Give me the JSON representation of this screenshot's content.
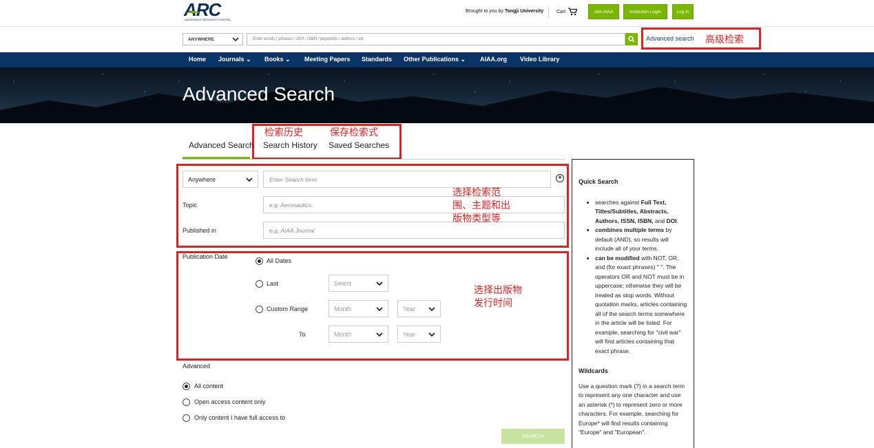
{
  "header": {
    "logo_text": "ARC",
    "logo_sub": "AEROSPACE RESEARCH CENTRAL",
    "brought_prefix": "Brought to you by",
    "institution": "Tongji University",
    "cart_label": "Cart",
    "buttons": [
      "Join AIAA",
      "Institution Login",
      "Log In"
    ]
  },
  "search": {
    "scope": "ANYWHERE",
    "placeholder": "Enter words / phrases / DOI / ISBN / keywords / authors / etc",
    "advanced_link": "Advanced search"
  },
  "nav": {
    "items": [
      "Home",
      "Journals",
      "Books",
      "Meeting Papers",
      "Standards",
      "Other Publications",
      "AIAA.org",
      "Video Library"
    ]
  },
  "hero": {
    "title": "Advanced Search"
  },
  "tabs": [
    "Advanced Search",
    "Search History",
    "Saved Searches"
  ],
  "annotations": {
    "advanced": "高级检索",
    "history": "检索历史",
    "saved": "保存检索式",
    "scope_line1": "选择检索范",
    "scope_line2": "围、主题和出",
    "scope_line3": "版物类型等",
    "date_line1": "选择出版物",
    "date_line2": "发行时间"
  },
  "form": {
    "field_select": "Anywhere",
    "term_placeholder": "Enter Search term",
    "topic_label": "Topic",
    "topic_placeholder": "e.g. Aeronautics",
    "published_label": "Published in",
    "published_placeholder": "e.g. AIAA Journal",
    "pubdate_label": "Publication Date",
    "date_options": [
      "All Dates",
      "Last",
      "Custom Range"
    ],
    "last_select": "Select",
    "month": "Month",
    "year": "Year",
    "to_label": "To",
    "advanced_label": "Advanced",
    "access_options": [
      "All content",
      "Open access content only",
      "Only content I have full access to"
    ],
    "search_button": "SEARCH"
  },
  "sidebar": {
    "quick_title": "Quick Search",
    "b1_pre": "searches against ",
    "b1_bold": "Full Text, Titles/Subtitles, Abstracts, Authors, ISSN, ISBN,",
    "b1_and": " and ",
    "b1_doi": "DOI",
    "b1_end": ".",
    "b2_bold": "combines multiple terms",
    "b2_rest": " by default (AND), so results will include all of your terms.",
    "b3_bold": "can be modified",
    "b3_rest": " with NOT, OR, and (for exact phrases) \" \". The operators OR and NOT must be in uppercase; otherwise they will be treated as stop words. Without quotation marks, articles containing all of the search terms somewhere in the article will be listed. For example, searching for \"civil war\" will find articles containing that exact phrase.",
    "wild_title": "Wildcards",
    "wild_text": "Use a question mark (?) in a search term to represent any one character and use an asterisk (*) to represent zero or more characters. For example, searching for Europe* will find results containing \"Europe\" and \"European\"."
  },
  "colors": {
    "brand_green": "#7ab800",
    "nav_blue": "#0b3466",
    "annotation_red": "#e02020"
  }
}
